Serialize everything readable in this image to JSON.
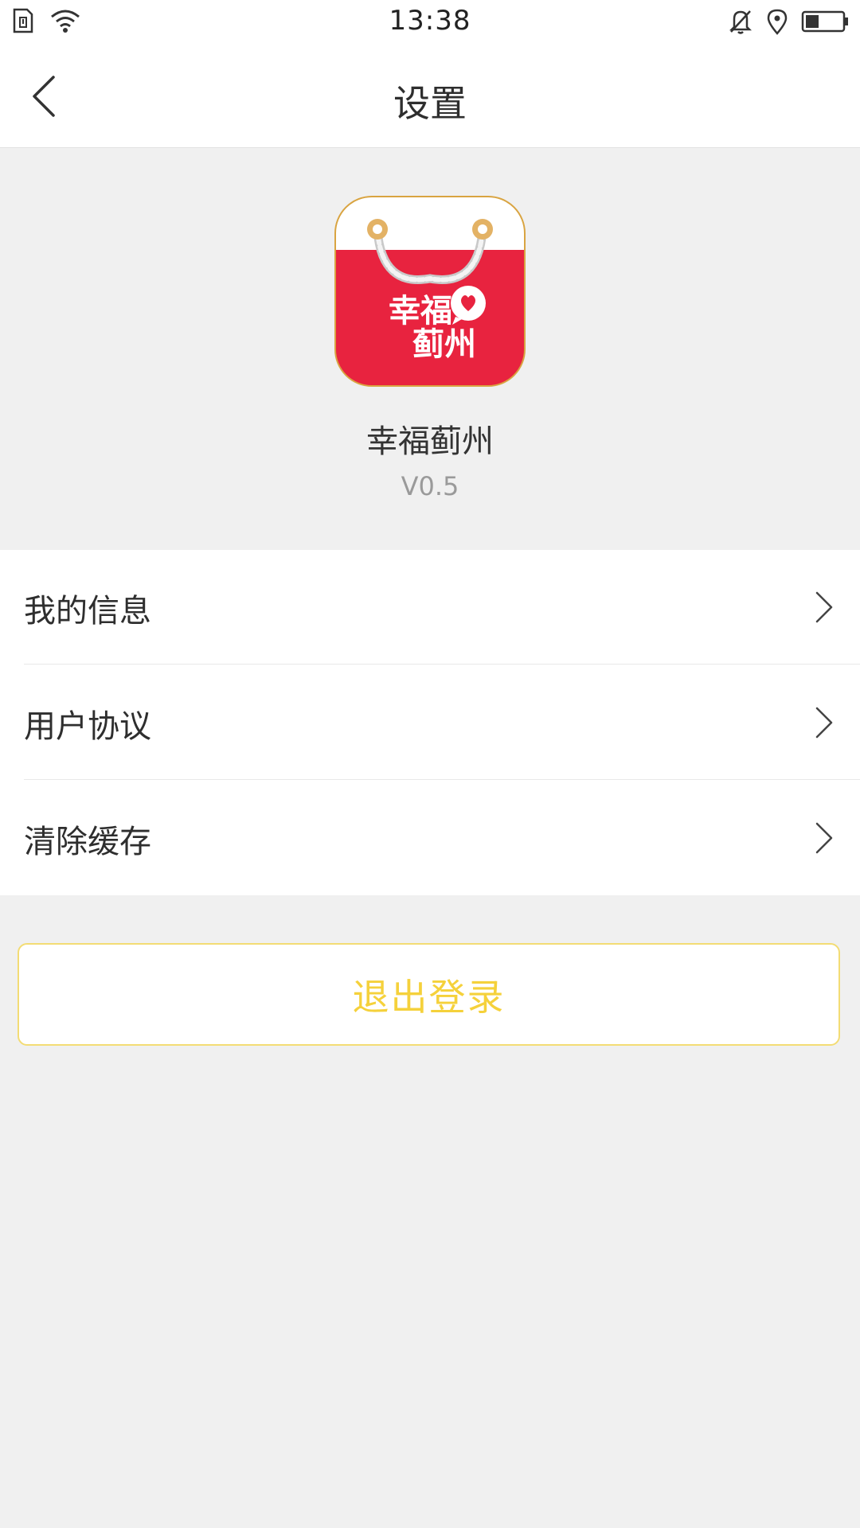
{
  "status_bar": {
    "time": "13:38",
    "left_icons": [
      "sim-icon",
      "wifi-icon"
    ],
    "right_icons": [
      "bell-muted-icon",
      "location-icon",
      "battery-icon"
    ]
  },
  "nav": {
    "title": "设置",
    "back_icon": "back-arrow-icon"
  },
  "app": {
    "logo_icon": "shopping-bag-logo-icon",
    "name": "幸福蓟州",
    "version": "V0.5",
    "logo_text_line1": "幸福",
    "logo_text_line2": "蓟州"
  },
  "menu": {
    "items": [
      {
        "label": "我的信息",
        "icon": "chevron-right-icon"
      },
      {
        "label": "用户协议",
        "icon": "chevron-right-icon"
      },
      {
        "label": "清除缓存",
        "icon": "chevron-right-icon"
      }
    ]
  },
  "logout": {
    "label": "退出登录"
  },
  "colors": {
    "background": "#f0f0f0",
    "logo_red": "#e8233f",
    "logout_text": "#f5d13b",
    "logout_border": "#f3dc74"
  }
}
